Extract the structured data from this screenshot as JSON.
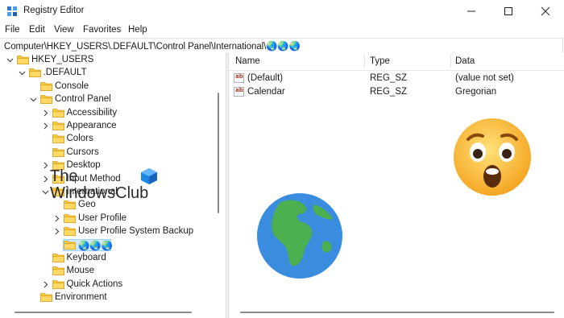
{
  "window": {
    "title": "Registry Editor",
    "controls": {
      "minimize": "minimize-icon",
      "maximize": "maximize-icon",
      "close": "close-icon"
    }
  },
  "menu": [
    "File",
    "Edit",
    "View",
    "Favorites",
    "Help"
  ],
  "address": "Computer\\HKEY_USERS\\.DEFAULT\\Control Panel\\International\\🌏🌏🌏",
  "tree": [
    {
      "label": "HKEY_USERS",
      "depth": 0,
      "state": "expanded"
    },
    {
      "label": ".DEFAULT",
      "depth": 1,
      "state": "expanded"
    },
    {
      "label": "Console",
      "depth": 2,
      "state": "leaf"
    },
    {
      "label": "Control Panel",
      "depth": 2,
      "state": "expanded"
    },
    {
      "label": "Accessibility",
      "depth": 3,
      "state": "collapsed"
    },
    {
      "label": "Appearance",
      "depth": 3,
      "state": "collapsed"
    },
    {
      "label": "Colors",
      "depth": 3,
      "state": "leaf"
    },
    {
      "label": "Cursors",
      "depth": 3,
      "state": "leaf"
    },
    {
      "label": "Desktop",
      "depth": 3,
      "state": "collapsed"
    },
    {
      "label": "Input Method",
      "depth": 3,
      "state": "collapsed"
    },
    {
      "label": "International",
      "depth": 3,
      "state": "expanded"
    },
    {
      "label": "Geo",
      "depth": 4,
      "state": "leaf"
    },
    {
      "label": "User Profile",
      "depth": 4,
      "state": "collapsed"
    },
    {
      "label": "User Profile System Backup",
      "depth": 4,
      "state": "collapsed"
    },
    {
      "label": "🌏🌏🌏",
      "depth": 4,
      "state": "leaf",
      "selected": true
    },
    {
      "label": "Keyboard",
      "depth": 3,
      "state": "leaf"
    },
    {
      "label": "Mouse",
      "depth": 3,
      "state": "leaf"
    },
    {
      "label": "Quick Actions",
      "depth": 3,
      "state": "collapsed"
    },
    {
      "label": "Environment",
      "depth": 2,
      "state": "leaf"
    }
  ],
  "columns": [
    "Name",
    "Type",
    "Data"
  ],
  "values": [
    {
      "name": "(Default)",
      "type": "REG_SZ",
      "data": "(value not set)",
      "icon": "string-value-icon"
    },
    {
      "name": "Calendar",
      "type": "REG_SZ",
      "data": "Gregorian",
      "icon": "string-value-icon"
    }
  ],
  "watermark": {
    "line1": "The",
    "line2": "WindowsClub"
  },
  "colors": {
    "folder": "#f4c842",
    "selection": "#cde8ff",
    "accent": "#0078d4",
    "globe_ocean": "#3a8dde",
    "globe_land": "#4caf50",
    "emoji_face": "#ffc83d"
  }
}
